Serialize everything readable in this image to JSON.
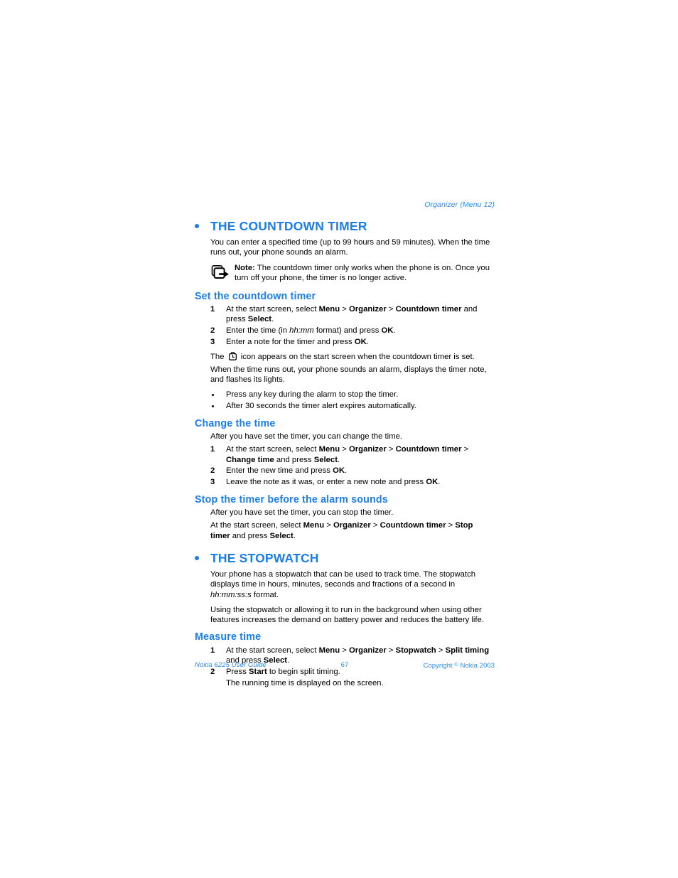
{
  "running_head": "Organizer (Menu 12)",
  "colors": {
    "heading_blue": "#1a7ef0",
    "footer_blue": "#2b8cf0",
    "body_black": "#000000",
    "page_background": "#ffffff"
  },
  "sections": {
    "countdown": {
      "title": "THE COUNTDOWN TIMER",
      "intro": "You can enter a specified time (up to 99 hours and 59 minutes). When the time runs out, your phone sounds an alarm.",
      "note": {
        "icon": "note-pointer-icon",
        "label": "Note:",
        "text": "The countdown timer only works when the phone is on. Once you turn off your phone, the timer is no longer active."
      },
      "set": {
        "title": "Set the countdown timer",
        "steps": [
          {
            "num": "1",
            "parts": [
              {
                "t": "At the start screen, select ",
                "s": "plain"
              },
              {
                "t": "Menu",
                "s": "bold"
              },
              {
                "t": " > ",
                "s": "plain"
              },
              {
                "t": "Organizer",
                "s": "bold"
              },
              {
                "t": " > ",
                "s": "plain"
              },
              {
                "t": "Countdown timer",
                "s": "bold"
              },
              {
                "t": " and press ",
                "s": "plain"
              },
              {
                "t": "Select",
                "s": "bold"
              },
              {
                "t": ".",
                "s": "plain"
              }
            ]
          },
          {
            "num": "2",
            "parts": [
              {
                "t": "Enter the time (in ",
                "s": "plain"
              },
              {
                "t": "hh:mm",
                "s": "italic"
              },
              {
                "t": " format) and press ",
                "s": "plain"
              },
              {
                "t": "OK",
                "s": "bold"
              },
              {
                "t": ".",
                "s": "plain"
              }
            ]
          },
          {
            "num": "3",
            "parts": [
              {
                "t": "Enter a note for the timer and press ",
                "s": "plain"
              },
              {
                "t": "OK",
                "s": "bold"
              },
              {
                "t": ".",
                "s": "plain"
              }
            ]
          }
        ],
        "icon_line_before": "The",
        "icon_name": "countdown-timer-icon",
        "icon_line_after": "icon appears on the start screen when the countdown timer is set.",
        "after_paragraph": "When the time runs out, your phone sounds an alarm, displays the timer note, and flashes its lights.",
        "bullets": [
          "Press any key during the alarm to stop the timer.",
          "After 30 seconds the timer alert expires automatically."
        ]
      },
      "change": {
        "title": "Change the time",
        "intro": "After you have set the timer, you can change the time.",
        "steps": [
          {
            "num": "1",
            "parts": [
              {
                "t": "At the start screen, select ",
                "s": "plain"
              },
              {
                "t": "Menu",
                "s": "bold"
              },
              {
                "t": " > ",
                "s": "plain"
              },
              {
                "t": "Organizer",
                "s": "bold"
              },
              {
                "t": " > ",
                "s": "plain"
              },
              {
                "t": "Countdown timer",
                "s": "bold"
              },
              {
                "t": " > ",
                "s": "plain"
              },
              {
                "t": "Change time",
                "s": "bold"
              },
              {
                "t": " and press ",
                "s": "plain"
              },
              {
                "t": "Select",
                "s": "bold"
              },
              {
                "t": ".",
                "s": "plain"
              }
            ]
          },
          {
            "num": "2",
            "parts": [
              {
                "t": "Enter the new time and press ",
                "s": "plain"
              },
              {
                "t": "OK",
                "s": "bold"
              },
              {
                "t": ".",
                "s": "plain"
              }
            ]
          },
          {
            "num": "3",
            "parts": [
              {
                "t": "Leave the note as it was, or enter a new note and press ",
                "s": "plain"
              },
              {
                "t": "OK",
                "s": "bold"
              },
              {
                "t": ".",
                "s": "plain"
              }
            ]
          }
        ]
      },
      "stop": {
        "title": "Stop the timer before the alarm sounds",
        "intro": "After you have set the timer, you can stop the timer.",
        "instruction_parts": [
          {
            "t": "At the start screen, select ",
            "s": "plain"
          },
          {
            "t": "Menu",
            "s": "bold"
          },
          {
            "t": " > ",
            "s": "plain"
          },
          {
            "t": "Organizer",
            "s": "bold"
          },
          {
            "t": " > ",
            "s": "plain"
          },
          {
            "t": "Countdown timer",
            "s": "bold"
          },
          {
            "t": " > ",
            "s": "plain"
          },
          {
            "t": "Stop timer",
            "s": "bold"
          },
          {
            "t": " and press ",
            "s": "plain"
          },
          {
            "t": "Select",
            "s": "bold"
          },
          {
            "t": ".",
            "s": "plain"
          }
        ]
      }
    },
    "stopwatch": {
      "title": "THE STOPWATCH",
      "intro_parts": [
        {
          "t": "Your phone has a stopwatch that can be used to track time. The stopwatch displays time in hours, minutes, seconds and fractions of a second in ",
          "s": "plain"
        },
        {
          "t": "hh:mm:ss:s",
          "s": "italic"
        },
        {
          "t": " format.",
          "s": "plain"
        }
      ],
      "battery_note": "Using the stopwatch or allowing it to run in the background when using other features increases the demand on battery power and reduces the battery life.",
      "measure": {
        "title": "Measure time",
        "steps": [
          {
            "num": "1",
            "parts": [
              {
                "t": "At the start screen, select ",
                "s": "plain"
              },
              {
                "t": "Menu",
                "s": "bold"
              },
              {
                "t": " > ",
                "s": "plain"
              },
              {
                "t": "Organizer",
                "s": "bold"
              },
              {
                "t": " > ",
                "s": "plain"
              },
              {
                "t": "Stopwatch",
                "s": "bold"
              },
              {
                "t": " > ",
                "s": "plain"
              },
              {
                "t": "Split timing",
                "s": "bold"
              },
              {
                "t": " and press ",
                "s": "plain"
              },
              {
                "t": "Select",
                "s": "bold"
              },
              {
                "t": ".",
                "s": "plain"
              }
            ]
          },
          {
            "num": "2",
            "parts": [
              {
                "t": "Press ",
                "s": "plain"
              },
              {
                "t": "Start",
                "s": "bold"
              },
              {
                "t": " to begin split timing.",
                "s": "plain"
              }
            ]
          }
        ],
        "sub_note": "The running time is displayed on the screen."
      }
    }
  },
  "footer": {
    "left": "Nokia 6225 User Guide",
    "page_number": "67",
    "copyright_before": "Copyright ",
    "copyright_symbol": "©",
    "copyright_after": " Nokia 2003"
  }
}
